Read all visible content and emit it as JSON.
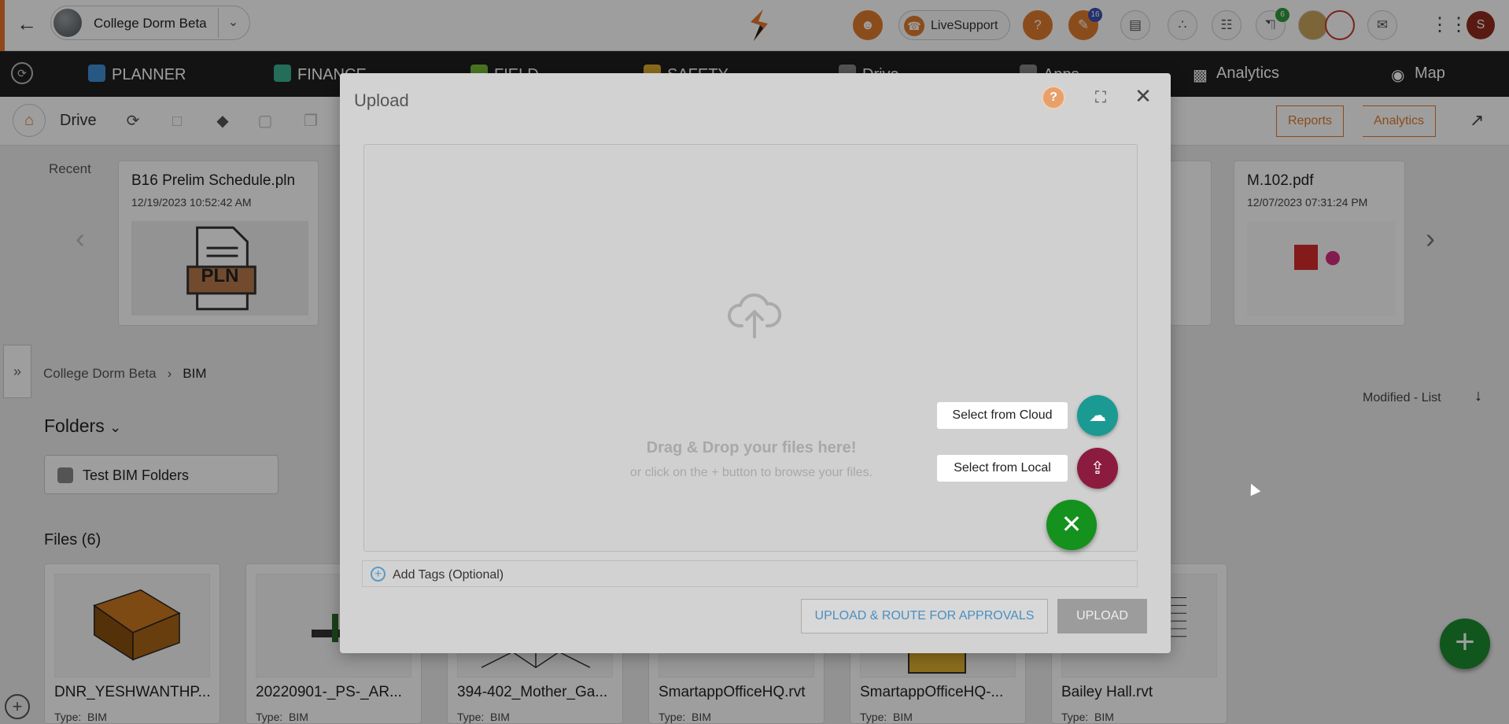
{
  "topbar": {
    "project_name": "College Dorm Beta",
    "live_support": "LiveSupport",
    "badge_notifications": "16",
    "badge_cart": "6",
    "user_initial": "S",
    "accent_color": "#e8762d"
  },
  "nav": {
    "items": [
      "PLANNER",
      "FINANCE",
      "FIELD",
      "SAFETY",
      "Drive",
      "Apps",
      "Analytics",
      "Map"
    ]
  },
  "drive": {
    "title": "Drive",
    "reports_label": "Reports",
    "analytics_label": "Analytics"
  },
  "recent": {
    "label": "Recent",
    "cards": [
      {
        "title": "B16 Prelim Schedule.pln",
        "date": "12/19/2023 10:52:42 AM",
        "thumb_text": "PLN"
      },
      {
        "title": "M.102.pdf",
        "date": "12/07/2023 07:31:24 PM"
      }
    ]
  },
  "breadcrumb": {
    "root": "College Dorm Beta",
    "current": "BIM"
  },
  "sort_label": "Modified - List",
  "folders": {
    "title": "Folders",
    "items": [
      "Test BIM Folders"
    ]
  },
  "files": {
    "title": "Files (6)",
    "type_prefix": "Type:",
    "items": [
      {
        "name": "DNR_YESHWANTHP...",
        "type": "BIM"
      },
      {
        "name": "20220901-_PS-_AR...",
        "type": "BIM"
      },
      {
        "name": "394-402_Mother_Ga...",
        "type": "BIM"
      },
      {
        "name": "SmartappOfficeHQ.rvt",
        "type": "BIM"
      },
      {
        "name": "SmartappOfficeHQ-...",
        "type": "BIM"
      },
      {
        "name": "Bailey Hall.rvt",
        "type": "BIM"
      }
    ]
  },
  "modal": {
    "title": "Upload",
    "drop_text": "Drag & Drop your files here!",
    "drop_sub": "or click on the + button to browse your files.",
    "select_cloud": "Select from Cloud",
    "select_local": "Select from Local",
    "tags_label": "Add Tags (Optional)",
    "route_button": "UPLOAD & ROUTE FOR APPROVALS",
    "upload_button": "UPLOAD",
    "cloud_color": "#1a9a93",
    "local_color": "#8c1c3f",
    "close_fab_color": "#15911e"
  }
}
